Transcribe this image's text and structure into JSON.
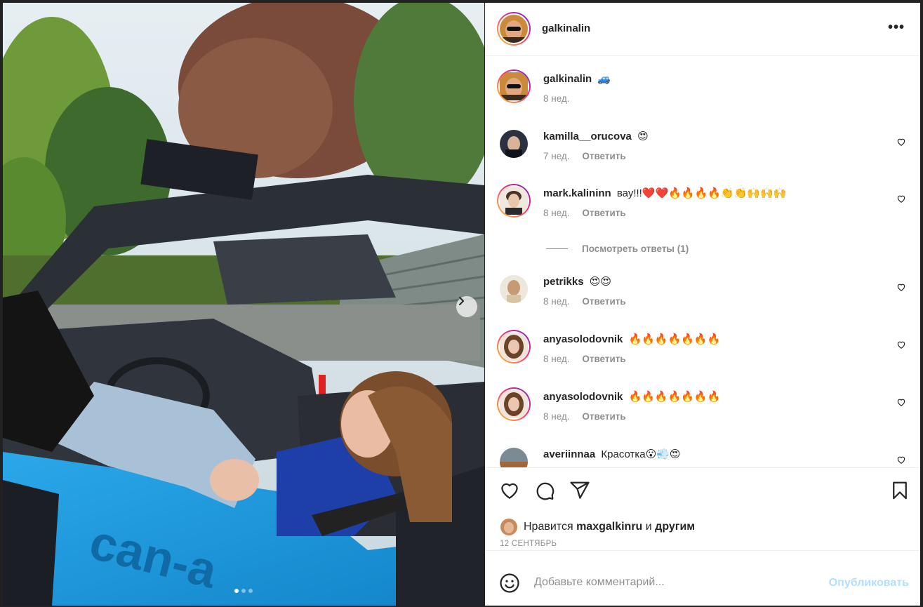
{
  "post": {
    "author": "galkinalin",
    "caption_emoji": "🚙",
    "caption_time": "8 нед.",
    "media_slides": 3,
    "active_slide": 1
  },
  "header": {
    "username": "galkinalin",
    "more_label": "•••"
  },
  "comments": [
    {
      "username": "kamilla__orucova",
      "text": "😍",
      "time": "7 нед.",
      "reply": "Ответить",
      "ring": false
    },
    {
      "username": "mark.kalininn",
      "text": "вау!!!❤️❤️🔥🔥🔥🔥👏👏🙌🙌🙌",
      "time": "8 нед.",
      "reply": "Ответить",
      "ring": true
    },
    {
      "username": "petrikks",
      "text": "😍😍",
      "time": "8 нед.",
      "reply": "Ответить",
      "ring": false
    },
    {
      "username": "anyasolodovnik",
      "text": "🔥🔥🔥🔥🔥🔥🔥",
      "time": "8 нед.",
      "reply": "Ответить",
      "ring": true
    },
    {
      "username": "anyasolodovnik",
      "text": "🔥🔥🔥🔥🔥🔥🔥",
      "time": "8 нед.",
      "reply": "Ответить",
      "ring": true
    },
    {
      "username": "averiinnaa",
      "text": "Красотка😮💨😍",
      "time": "",
      "reply": "",
      "ring": false
    }
  ],
  "view_replies": "Посмотреть ответы (1)",
  "likes": {
    "prefix": "Нравится",
    "user": "maxgalkinru",
    "conj": "и",
    "others": "другим"
  },
  "date": "12 СЕНТЯБРЬ",
  "composer": {
    "placeholder": "Добавьте комментарий...",
    "publish": "Опубликовать"
  },
  "colors": {
    "text": "#262626",
    "muted": "#8e8e8e",
    "publish_disabled": "#b2dffc",
    "vehicle_blue": "#1e9fe0"
  },
  "icons": [
    "heart-icon",
    "comment-icon",
    "share-icon",
    "bookmark-icon",
    "emoji-icon",
    "more-icon",
    "chevron-right-icon"
  ]
}
